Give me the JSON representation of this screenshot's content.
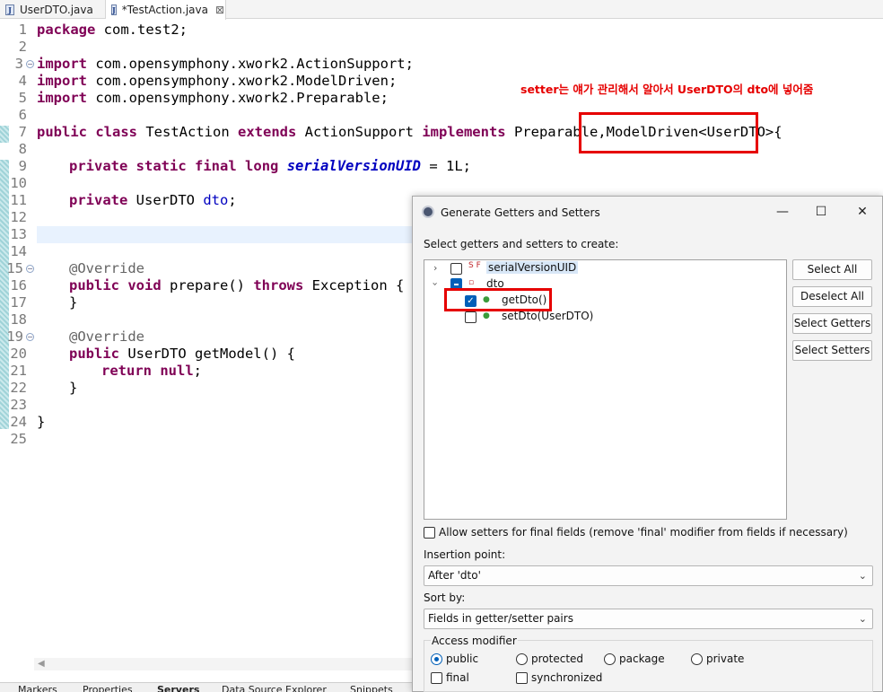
{
  "tabs": [
    {
      "label": "UserDTO.java"
    },
    {
      "label": "*TestAction.java"
    }
  ],
  "code": {
    "line_numbers": [
      "1",
      "2",
      "3",
      "4",
      "5",
      "6",
      "7",
      "8",
      "9",
      "10",
      "11",
      "12",
      "13",
      "14",
      "15",
      "16",
      "17",
      "18",
      "19",
      "20",
      "21",
      "22",
      "23",
      "24",
      "25"
    ],
    "l1_kw": "package",
    "l1_rest": " com.test2;",
    "l3_kw": "import",
    "l3_rest": " com.opensymphony.xwork2.ActionSupport;",
    "l4_kw": "import",
    "l4_rest": " com.opensymphony.xwork2.ModelDriven;",
    "l5_kw": "import",
    "l5_rest": " com.opensymphony.xwork2.Preparable;",
    "l7_kw1": "public",
    "l7_kw2": "class",
    "l7_name": " TestAction ",
    "l7_kw3": "extends",
    "l7_mid": " ActionSupport ",
    "l7_kw4": "implements",
    "l7_rest": " Preparable,ModelDriven<UserDTO>{",
    "l9_kw1": "private",
    "l9_kw2": "static",
    "l9_kw3": "final",
    "l9_kw4": "long",
    "l9_field": "serialVersionUID",
    "l9_rest": " = 1L;",
    "l11_kw": "private",
    "l11_type": " UserDTO ",
    "l11_field": "dto",
    "l11_rest": ";",
    "l15_ann": "@Override",
    "l16_kw1": "public",
    "l16_kw2": "void",
    "l16_mid": " prepare() ",
    "l16_kw3": "throws",
    "l16_rest": " Exception {",
    "l17": "}",
    "l19_ann": "@Override",
    "l20_kw": "public",
    "l20_rest": " UserDTO getModel() {",
    "l21_kw1": "return",
    "l21_kw2": "null",
    "l21_rest": ";",
    "l22": "}",
    "l24": "}"
  },
  "annotation_note": "setter는 얘가 관리해서 알아서 UserDTO의 dto에 넣어줌",
  "bottom_tabs": [
    "Markers",
    "Properties",
    "Servers",
    "Data Source Explorer",
    "Snippets"
  ],
  "dialog": {
    "title": "Generate Getters and Setters",
    "select_label": "Select getters and setters to create:",
    "tree": [
      {
        "label": "serialVersionUID",
        "badge": "S F"
      },
      {
        "label": "dto"
      },
      {
        "label": "getDto()"
      },
      {
        "label": "setDto(UserDTO)"
      }
    ],
    "buttons": {
      "select_all": "Select All",
      "deselect_all": "Deselect All",
      "select_getters": "Select Getters",
      "select_setters": "Select Setters"
    },
    "allow_final_label": "Allow setters for final fields (remove 'final' modifier from fields if necessary)",
    "insertion_point_label": "Insertion point:",
    "insertion_point_value": "After 'dto'",
    "sort_by_label": "Sort by:",
    "sort_by_value": "Fields in getter/setter pairs",
    "access_modifier_label": "Access modifier",
    "access_modifiers": [
      "public",
      "protected",
      "package",
      "private"
    ],
    "final_label": "final",
    "synchronized_label": "synchronized"
  },
  "colors": {
    "highlight_red": "#e60000",
    "keyword": "#7f0055",
    "field": "#0000c0",
    "accent": "#005fb8"
  }
}
